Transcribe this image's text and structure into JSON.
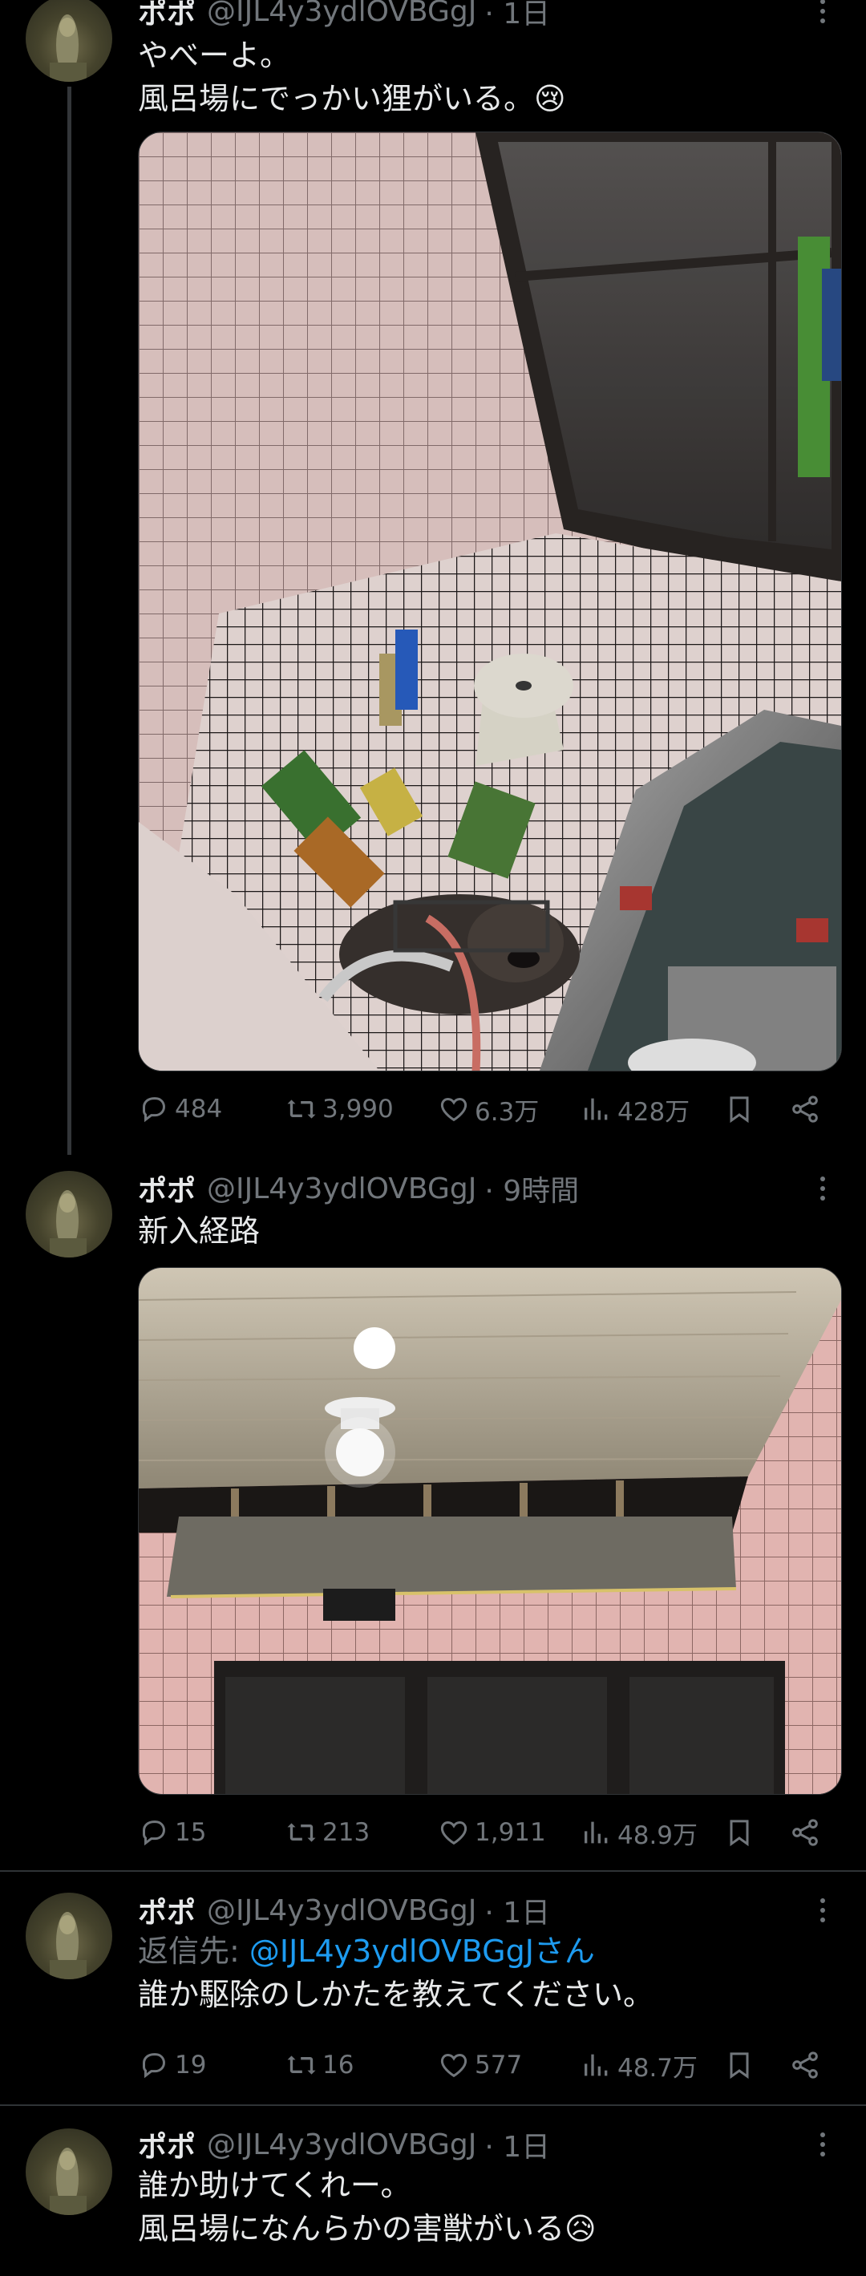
{
  "tweets": [
    {
      "name": "ポポ",
      "handle": "@IJL4y3ydlOVBGgJ",
      "time": "· 1日",
      "lines": [
        "やべーよ。",
        "風呂場にでっかい狸がいる。😢"
      ],
      "media_icon": "raccoon-dog-in-bathroom-photo",
      "stats": {
        "replies": "484",
        "retweets": "3,990",
        "likes": "6.3万",
        "views": "428万"
      }
    },
    {
      "name": "ポポ",
      "handle": "@IJL4y3ydlOVBGgJ",
      "time": "· 9時間",
      "lines": [
        "新入経路"
      ],
      "media_icon": "bathroom-ceiling-gap-photo",
      "stats": {
        "replies": "15",
        "retweets": "213",
        "likes": "1,911",
        "views": "48.9万"
      }
    },
    {
      "name": "ポポ",
      "handle": "@IJL4y3ydlOVBGgJ",
      "time": "· 1日",
      "reply_prefix": "返信先: ",
      "reply_mention": "@IJL4y3ydlOVBGgJさん",
      "lines": [
        "誰か駆除のしかたを教えてください。"
      ],
      "stats": {
        "replies": "19",
        "retweets": "16",
        "likes": "577",
        "views": "48.7万"
      }
    },
    {
      "name": "ポポ",
      "handle": "@IJL4y3ydlOVBGgJ",
      "time": "· 1日",
      "lines": [
        "誰か助けてくれー。",
        "風呂場になんらかの害獣がいる😥"
      ]
    }
  ],
  "colors": {
    "background": "#000000",
    "text": "#e7e9ea",
    "muted": "#71767b",
    "link": "#1d9bf0",
    "divider": "#2f3336"
  }
}
